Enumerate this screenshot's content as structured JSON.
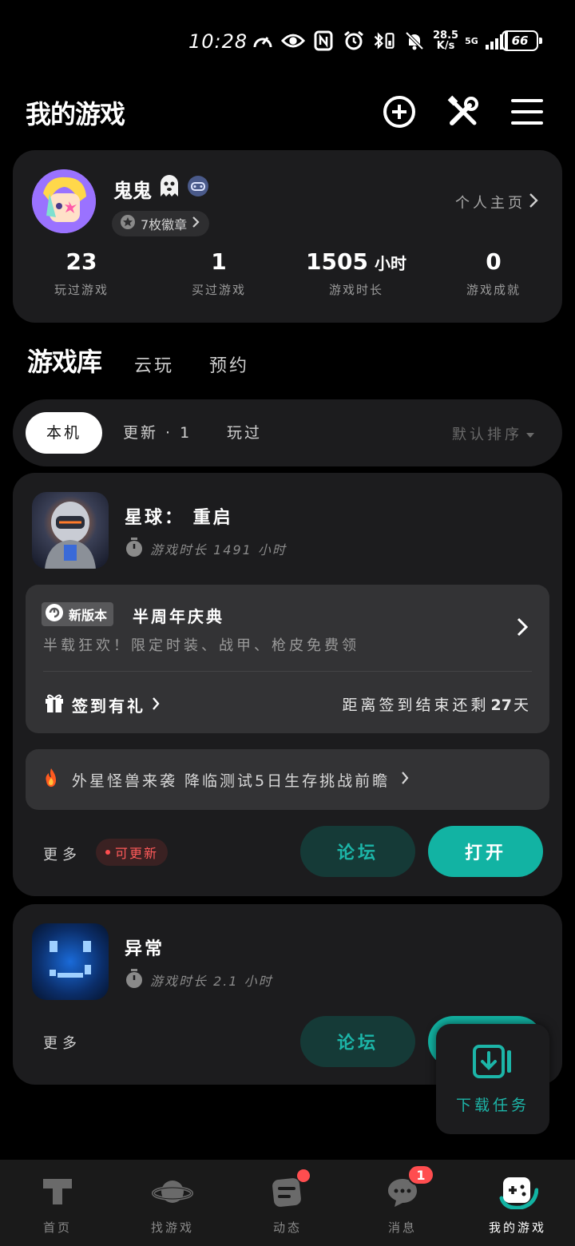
{
  "status_bar": {
    "time": "10:28",
    "net_speed_value": "28.5",
    "net_speed_unit": "K/s",
    "network": "5G",
    "battery": "66"
  },
  "header": {
    "title": "我的游戏",
    "icons": [
      "add-circle-icon",
      "tools-icon",
      "menu-icon"
    ]
  },
  "profile": {
    "username": "鬼鬼",
    "badges_label": "7枚徽章",
    "homepage_link": "个人主页",
    "stats": [
      {
        "value": "23",
        "unit": "",
        "label": "玩过游戏"
      },
      {
        "value": "1",
        "unit": "",
        "label": "买过游戏"
      },
      {
        "value": "1505",
        "unit": "小时",
        "label": "游戏时长"
      },
      {
        "value": "0",
        "unit": "",
        "label": "游戏成就"
      }
    ]
  },
  "main_tabs": [
    {
      "label": "游戏库",
      "active": true
    },
    {
      "label": "云玩",
      "active": false
    },
    {
      "label": "预约",
      "active": false
    }
  ],
  "filters": {
    "chips": [
      {
        "label": "本机",
        "active": true
      },
      {
        "label": "更新 · 1",
        "active": false
      },
      {
        "label": "玩过",
        "active": false
      }
    ],
    "sort_label": "默认排序"
  },
  "games": [
    {
      "name": "星球： 重启",
      "playtime": "游戏时长 1491 小时",
      "event": {
        "tag": "新版本",
        "title": "半周年庆典",
        "description": "半载狂欢！限定时装、战甲、枪皮免费领",
        "signin_label": "签到有礼",
        "countdown_prefix": "距离签到结束还剩",
        "countdown_days": "27",
        "countdown_suffix": "天"
      },
      "news": "外星怪兽来袭 降临测试5日生存挑战前瞻",
      "more_label": "更多",
      "update_tag": "可更新",
      "forum_label": "论坛",
      "open_label": "打开"
    },
    {
      "name": "异常",
      "playtime": "游戏时长 2.1 小时",
      "more_label": "更多",
      "forum_label": "论坛"
    }
  ],
  "download_float": {
    "label": "下载任务"
  },
  "bottom_nav": [
    {
      "label": "首页",
      "icon": "home-icon",
      "active": false
    },
    {
      "label": "找游戏",
      "icon": "planet-icon",
      "active": false
    },
    {
      "label": "动态",
      "icon": "feed-icon",
      "active": false,
      "dot": true
    },
    {
      "label": "消息",
      "icon": "chat-icon",
      "active": false,
      "count": "1"
    },
    {
      "label": "我的游戏",
      "icon": "gamepad-icon",
      "active": true
    }
  ],
  "colors": {
    "accent": "#12b3a3",
    "card_bg": "#1c1c1e",
    "alert": "#ff4d4f"
  }
}
